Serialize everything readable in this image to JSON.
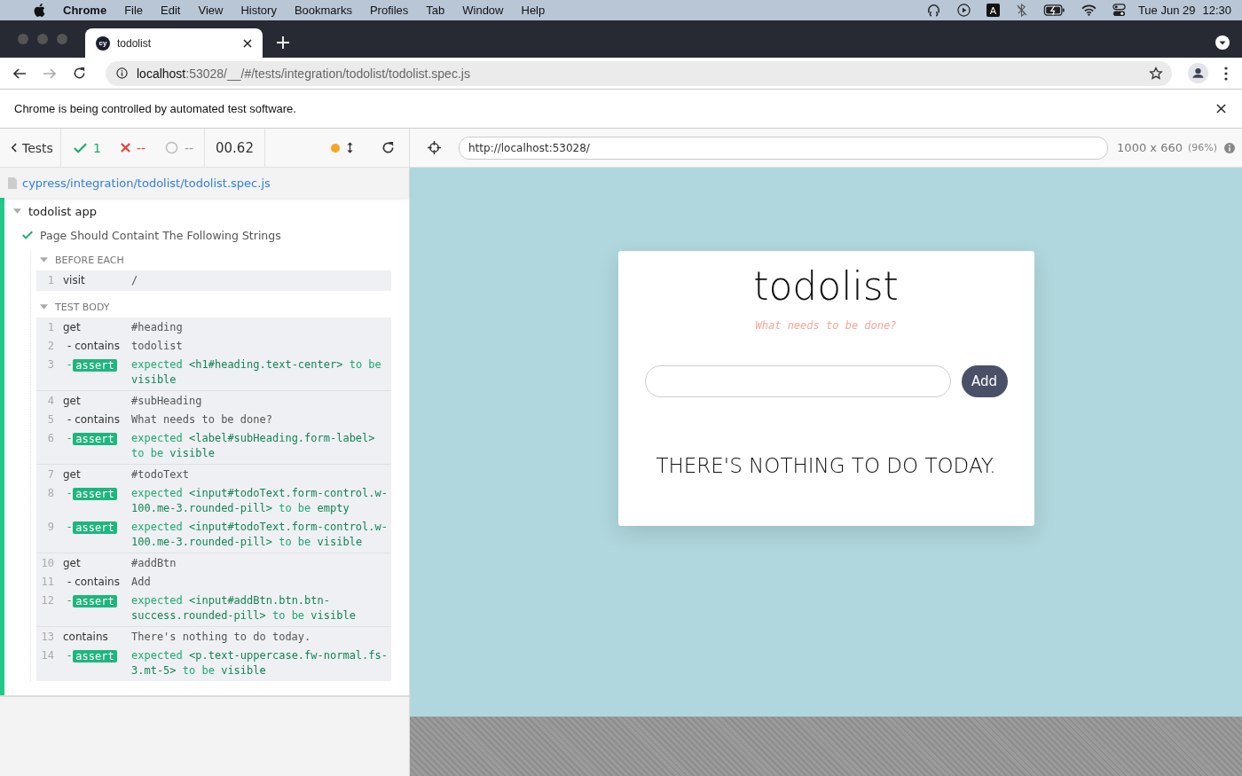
{
  "menu_bar": {
    "app": "Chrome",
    "items": [
      "File",
      "Edit",
      "View",
      "History",
      "Bookmarks",
      "Profiles",
      "Tab",
      "Window",
      "Help"
    ],
    "date": "Tue Jun 29",
    "time": "12:30",
    "input_source": "A"
  },
  "browser": {
    "tab": {
      "favicon": "cy",
      "title": "todolist",
      "selected": true
    },
    "address": {
      "host": "localhost",
      "path": ":53028/__/#/tests/integration/todolist/todolist.spec.js"
    },
    "infobar": "Chrome is being controlled by automated test software."
  },
  "runner": {
    "back": "Tests",
    "passed": "1",
    "failed": "--",
    "pending": "--",
    "duration": "00.62",
    "spec_file": "cypress/integration/todolist/todolist.spec.js",
    "suite": {
      "title": "todolist app",
      "expanded": true,
      "test": {
        "title": "Page Should Containt The Following Strings",
        "passed": true,
        "hooks": [
          {
            "title": "BEFORE EACH",
            "expanded": true,
            "groups": [
              [
                {
                  "number": "1",
                  "kind": "command",
                  "name": "visit",
                  "message": "/"
                }
              ]
            ]
          },
          {
            "title": "TEST BODY",
            "expanded": true,
            "groups": [
              [
                {
                  "number": "1",
                  "kind": "command",
                  "name": "get",
                  "message": "#heading"
                },
                {
                  "number": "2",
                  "kind": "child",
                  "name": "- contains",
                  "message": "todolist"
                },
                {
                  "number": "3",
                  "kind": "assert",
                  "prefix": "-",
                  "name": "assert",
                  "expected": "expected",
                  "subject": "<h1#heading.text-center>",
                  "predicate": "to be",
                  "value": "visible"
                }
              ],
              [
                {
                  "number": "4",
                  "kind": "command",
                  "name": "get",
                  "message": "#subHeading"
                },
                {
                  "number": "5",
                  "kind": "child",
                  "name": "- contains",
                  "message": "What needs to be done?"
                },
                {
                  "number": "6",
                  "kind": "assert",
                  "prefix": "-",
                  "name": "assert",
                  "expected": "expected",
                  "subject": "<label#subHeading.form-label>",
                  "predicate": "to be",
                  "value": "visible"
                }
              ],
              [
                {
                  "number": "7",
                  "kind": "command",
                  "name": "get",
                  "message": "#todoText"
                },
                {
                  "number": "8",
                  "kind": "assert",
                  "prefix": "-",
                  "name": "assert",
                  "expected": "expected",
                  "subject": "<input#todoText.form-control.w-100.me-3.rounded-pill>",
                  "predicate": "to be",
                  "value": "empty"
                },
                {
                  "number": "9",
                  "kind": "assert",
                  "prefix": "-",
                  "name": "assert",
                  "expected": "expected",
                  "subject": "<input#todoText.form-control.w-100.me-3.rounded-pill>",
                  "predicate": "to be",
                  "value": "visible"
                }
              ],
              [
                {
                  "number": "10",
                  "kind": "command",
                  "name": "get",
                  "message": "#addBtn"
                },
                {
                  "number": "11",
                  "kind": "child",
                  "name": "- contains",
                  "message": "Add"
                },
                {
                  "number": "12",
                  "kind": "assert",
                  "prefix": "-",
                  "name": "assert",
                  "expected": "expected",
                  "subject": "<input#addBtn.btn.btn-success.rounded-pill>",
                  "predicate": "to be",
                  "value": "visible"
                }
              ],
              [
                {
                  "number": "13",
                  "kind": "command",
                  "name": "contains",
                  "message": "There's nothing to do today."
                },
                {
                  "number": "14",
                  "kind": "assert",
                  "prefix": "-",
                  "name": "assert",
                  "expected": "expected",
                  "subject": "<p.text-uppercase.fw-normal.fs-3.mt-5>",
                  "predicate": "to be",
                  "value": "visible"
                }
              ]
            ]
          }
        ]
      }
    }
  },
  "preview": {
    "url": "http://localhost:53028/",
    "viewport": "1000 x 660",
    "scale": "(96%)",
    "app": {
      "heading": "todolist",
      "subheading": "What needs to be done?",
      "button": "Add",
      "empty_message": "THERE'S NOTHING TO DO TODAY."
    }
  }
}
